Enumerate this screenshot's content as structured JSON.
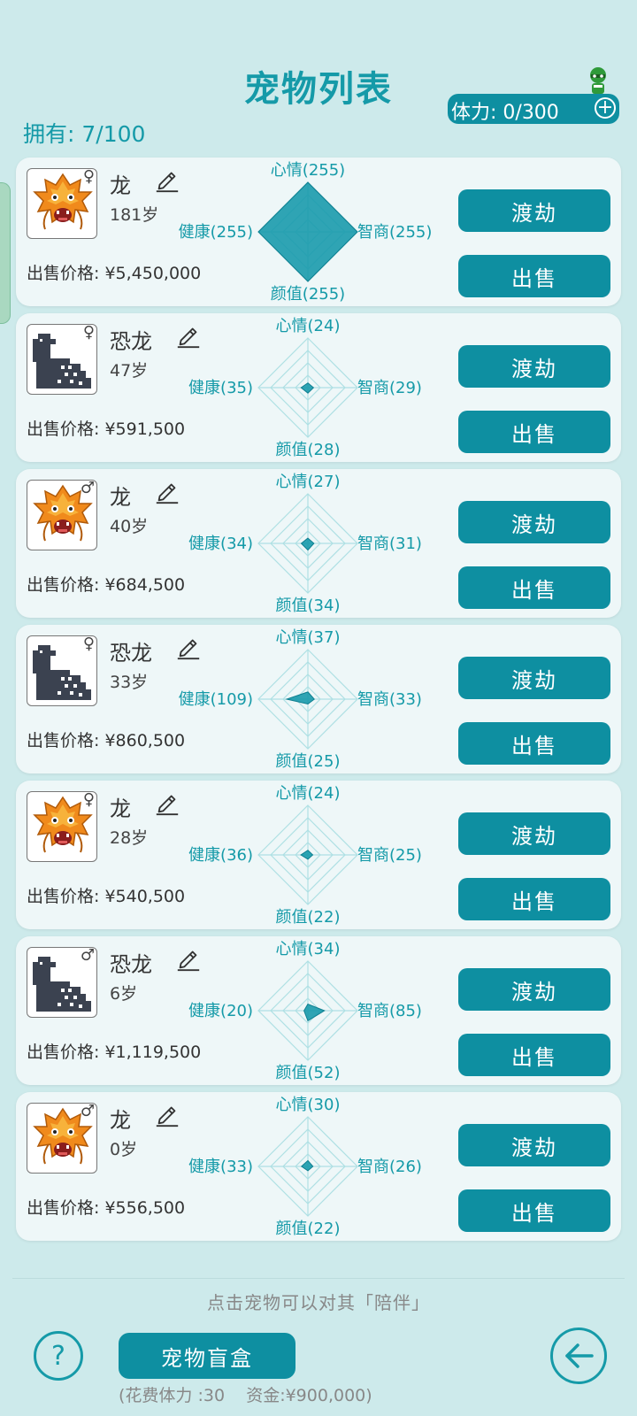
{
  "header": {
    "title": "宠物列表",
    "owned": "拥有: 7/100",
    "stamina": "体力: 0/300"
  },
  "labels": {
    "mood": "心情",
    "health": "健康",
    "iq": "智商",
    "looks": "颜值",
    "price_prefix": "出售价格: ",
    "btn_transcend": "渡劫",
    "btn_sell": "出售"
  },
  "pets": [
    {
      "type": "dragon",
      "name": "龙",
      "gender": "♀",
      "age": "181岁",
      "price": "¥5,450,000",
      "mood": 255,
      "health": 255,
      "iq": 255,
      "looks": 255
    },
    {
      "type": "dino",
      "name": "恐龙",
      "gender": "♀",
      "age": "47岁",
      "price": "¥591,500",
      "mood": 24,
      "health": 35,
      "iq": 29,
      "looks": 28
    },
    {
      "type": "dragon",
      "name": "龙",
      "gender": "♂",
      "age": "40岁",
      "price": "¥684,500",
      "mood": 27,
      "health": 34,
      "iq": 31,
      "looks": 34
    },
    {
      "type": "dino",
      "name": "恐龙",
      "gender": "♀",
      "age": "33岁",
      "price": "¥860,500",
      "mood": 37,
      "health": 109,
      "iq": 33,
      "looks": 25
    },
    {
      "type": "dragon",
      "name": "龙",
      "gender": "♀",
      "age": "28岁",
      "price": "¥540,500",
      "mood": 24,
      "health": 36,
      "iq": 25,
      "looks": 22
    },
    {
      "type": "dino",
      "name": "恐龙",
      "gender": "♂",
      "age": "6岁",
      "price": "¥1,119,500",
      "mood": 34,
      "health": 20,
      "iq": 85,
      "looks": 52
    },
    {
      "type": "dragon",
      "name": "龙",
      "gender": "♂",
      "age": "0岁",
      "price": "¥556,500",
      "mood": 30,
      "health": 33,
      "iq": 26,
      "looks": 22
    }
  ],
  "stat_max": 255,
  "footer": {
    "hint": "点击宠物可以对其「陪伴」",
    "help": "?",
    "blindbox": "宠物盲盒",
    "cost": "(花费体力 :30    资金:¥900,000)"
  },
  "colors": {
    "accent": "#159aa8",
    "button": "#0e8fa1",
    "background": "#cdeaeb",
    "card": "#eef7f8"
  },
  "icons": {
    "edit": "pencil-icon",
    "add": "plus-circle-icon",
    "back": "arrow-left-icon",
    "help": "question-icon"
  }
}
